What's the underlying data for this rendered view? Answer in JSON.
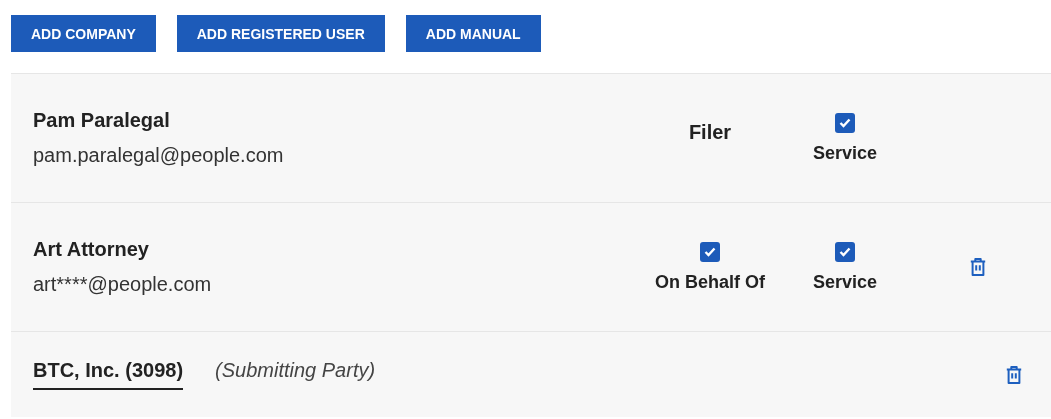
{
  "buttons": [
    "ADD COMPANY",
    "ADD REGISTERED USER",
    "ADD MANUAL"
  ],
  "entries": [
    {
      "kind": "person",
      "name": "Pam Paralegal",
      "email": "pam.paralegal@people.com",
      "roles": [
        {
          "kind": "text",
          "label": "Filer"
        },
        {
          "kind": "checkbox",
          "label": "Service",
          "checked": true
        }
      ],
      "removable": false
    },
    {
      "kind": "person",
      "name": "Art Attorney",
      "email": "art****@people.com",
      "roles": [
        {
          "kind": "checkbox",
          "label": "On Behalf Of",
          "checked": true
        },
        {
          "kind": "checkbox",
          "label": "Service",
          "checked": true
        }
      ],
      "removable": true
    },
    {
      "kind": "company",
      "name": "BTC, Inc. (3098)",
      "note": "(Submitting Party)",
      "removable": true
    }
  ]
}
